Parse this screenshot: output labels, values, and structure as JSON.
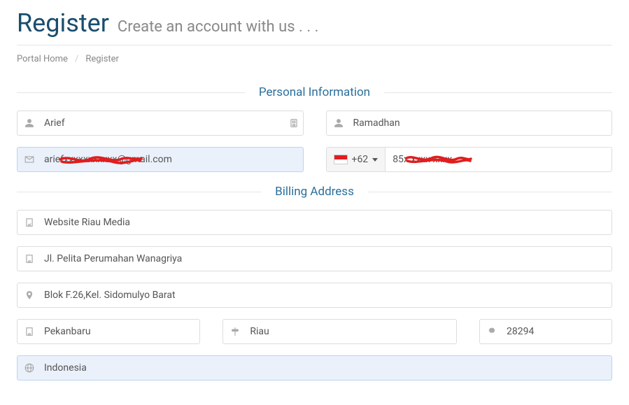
{
  "header": {
    "title": "Register",
    "subtitle": "Create an account with us . . ."
  },
  "breadcrumb": {
    "home": "Portal Home",
    "current": "Register"
  },
  "sections": {
    "personal": "Personal Information",
    "billing": "Billing Address"
  },
  "personal": {
    "first_name": "Arief",
    "last_name": "Ramadhan",
    "email": "ariefxxxxxxxxxxx@gmail.com",
    "phone_code": "+62",
    "phone": "85x xxxx xxxx"
  },
  "billing": {
    "company": "Website Riau Media",
    "address1": "Jl. Pelita Perumahan Wanagriya",
    "address2": "Blok F.26,Kel. Sidomulyo Barat",
    "city": "Pekanbaru",
    "state": "Riau",
    "postcode": "28294",
    "country": "Indonesia"
  }
}
